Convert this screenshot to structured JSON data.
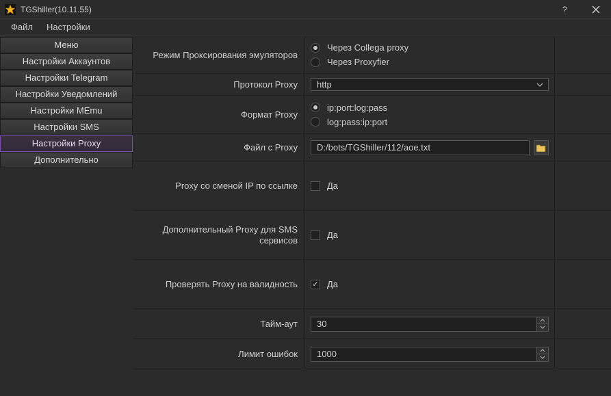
{
  "window": {
    "title": "TGShiller(10.11.55)"
  },
  "menubar": {
    "file": "Файл",
    "settings": "Настройки"
  },
  "sidebar": {
    "items": [
      {
        "label": "Меню"
      },
      {
        "label": "Настройки Аккаунтов"
      },
      {
        "label": "Настройки Telegram"
      },
      {
        "label": "Настройки Уведомлений"
      },
      {
        "label": "Настройки MEmu"
      },
      {
        "label": "Настройки SMS"
      },
      {
        "label": "Настройки Proxy"
      },
      {
        "label": "Дополнительно"
      }
    ]
  },
  "settings": {
    "proxy_mode": {
      "label": "Режим Проксирования эмуляторов",
      "opt_collega": "Через Collega proxy",
      "opt_proxyfier": "Через Proxyfier",
      "value": "collega"
    },
    "protocol": {
      "label": "Протокол Proxy",
      "value": "http"
    },
    "format": {
      "label": "Формат Proxy",
      "opt_a": "ip:port:log:pass",
      "opt_b": "log:pass:ip:port",
      "value": "a"
    },
    "file": {
      "label": "Файл с Proxy",
      "value": "D:/bots/TGShiller/112/aoe.txt"
    },
    "ip_change": {
      "label": "Proxy со сменой IP по ссылке",
      "check_label": "Да",
      "value": false
    },
    "extra_sms": {
      "label": "Дополнительный Proxy для SMS сервисов",
      "check_label": "Да",
      "value": false
    },
    "validate": {
      "label": "Проверять Proxy на валидность",
      "check_label": "Да",
      "value": true
    },
    "timeout": {
      "label": "Тайм-аут",
      "value": "30"
    },
    "error_limit": {
      "label": "Лимит ошибок",
      "value": "1000"
    }
  }
}
